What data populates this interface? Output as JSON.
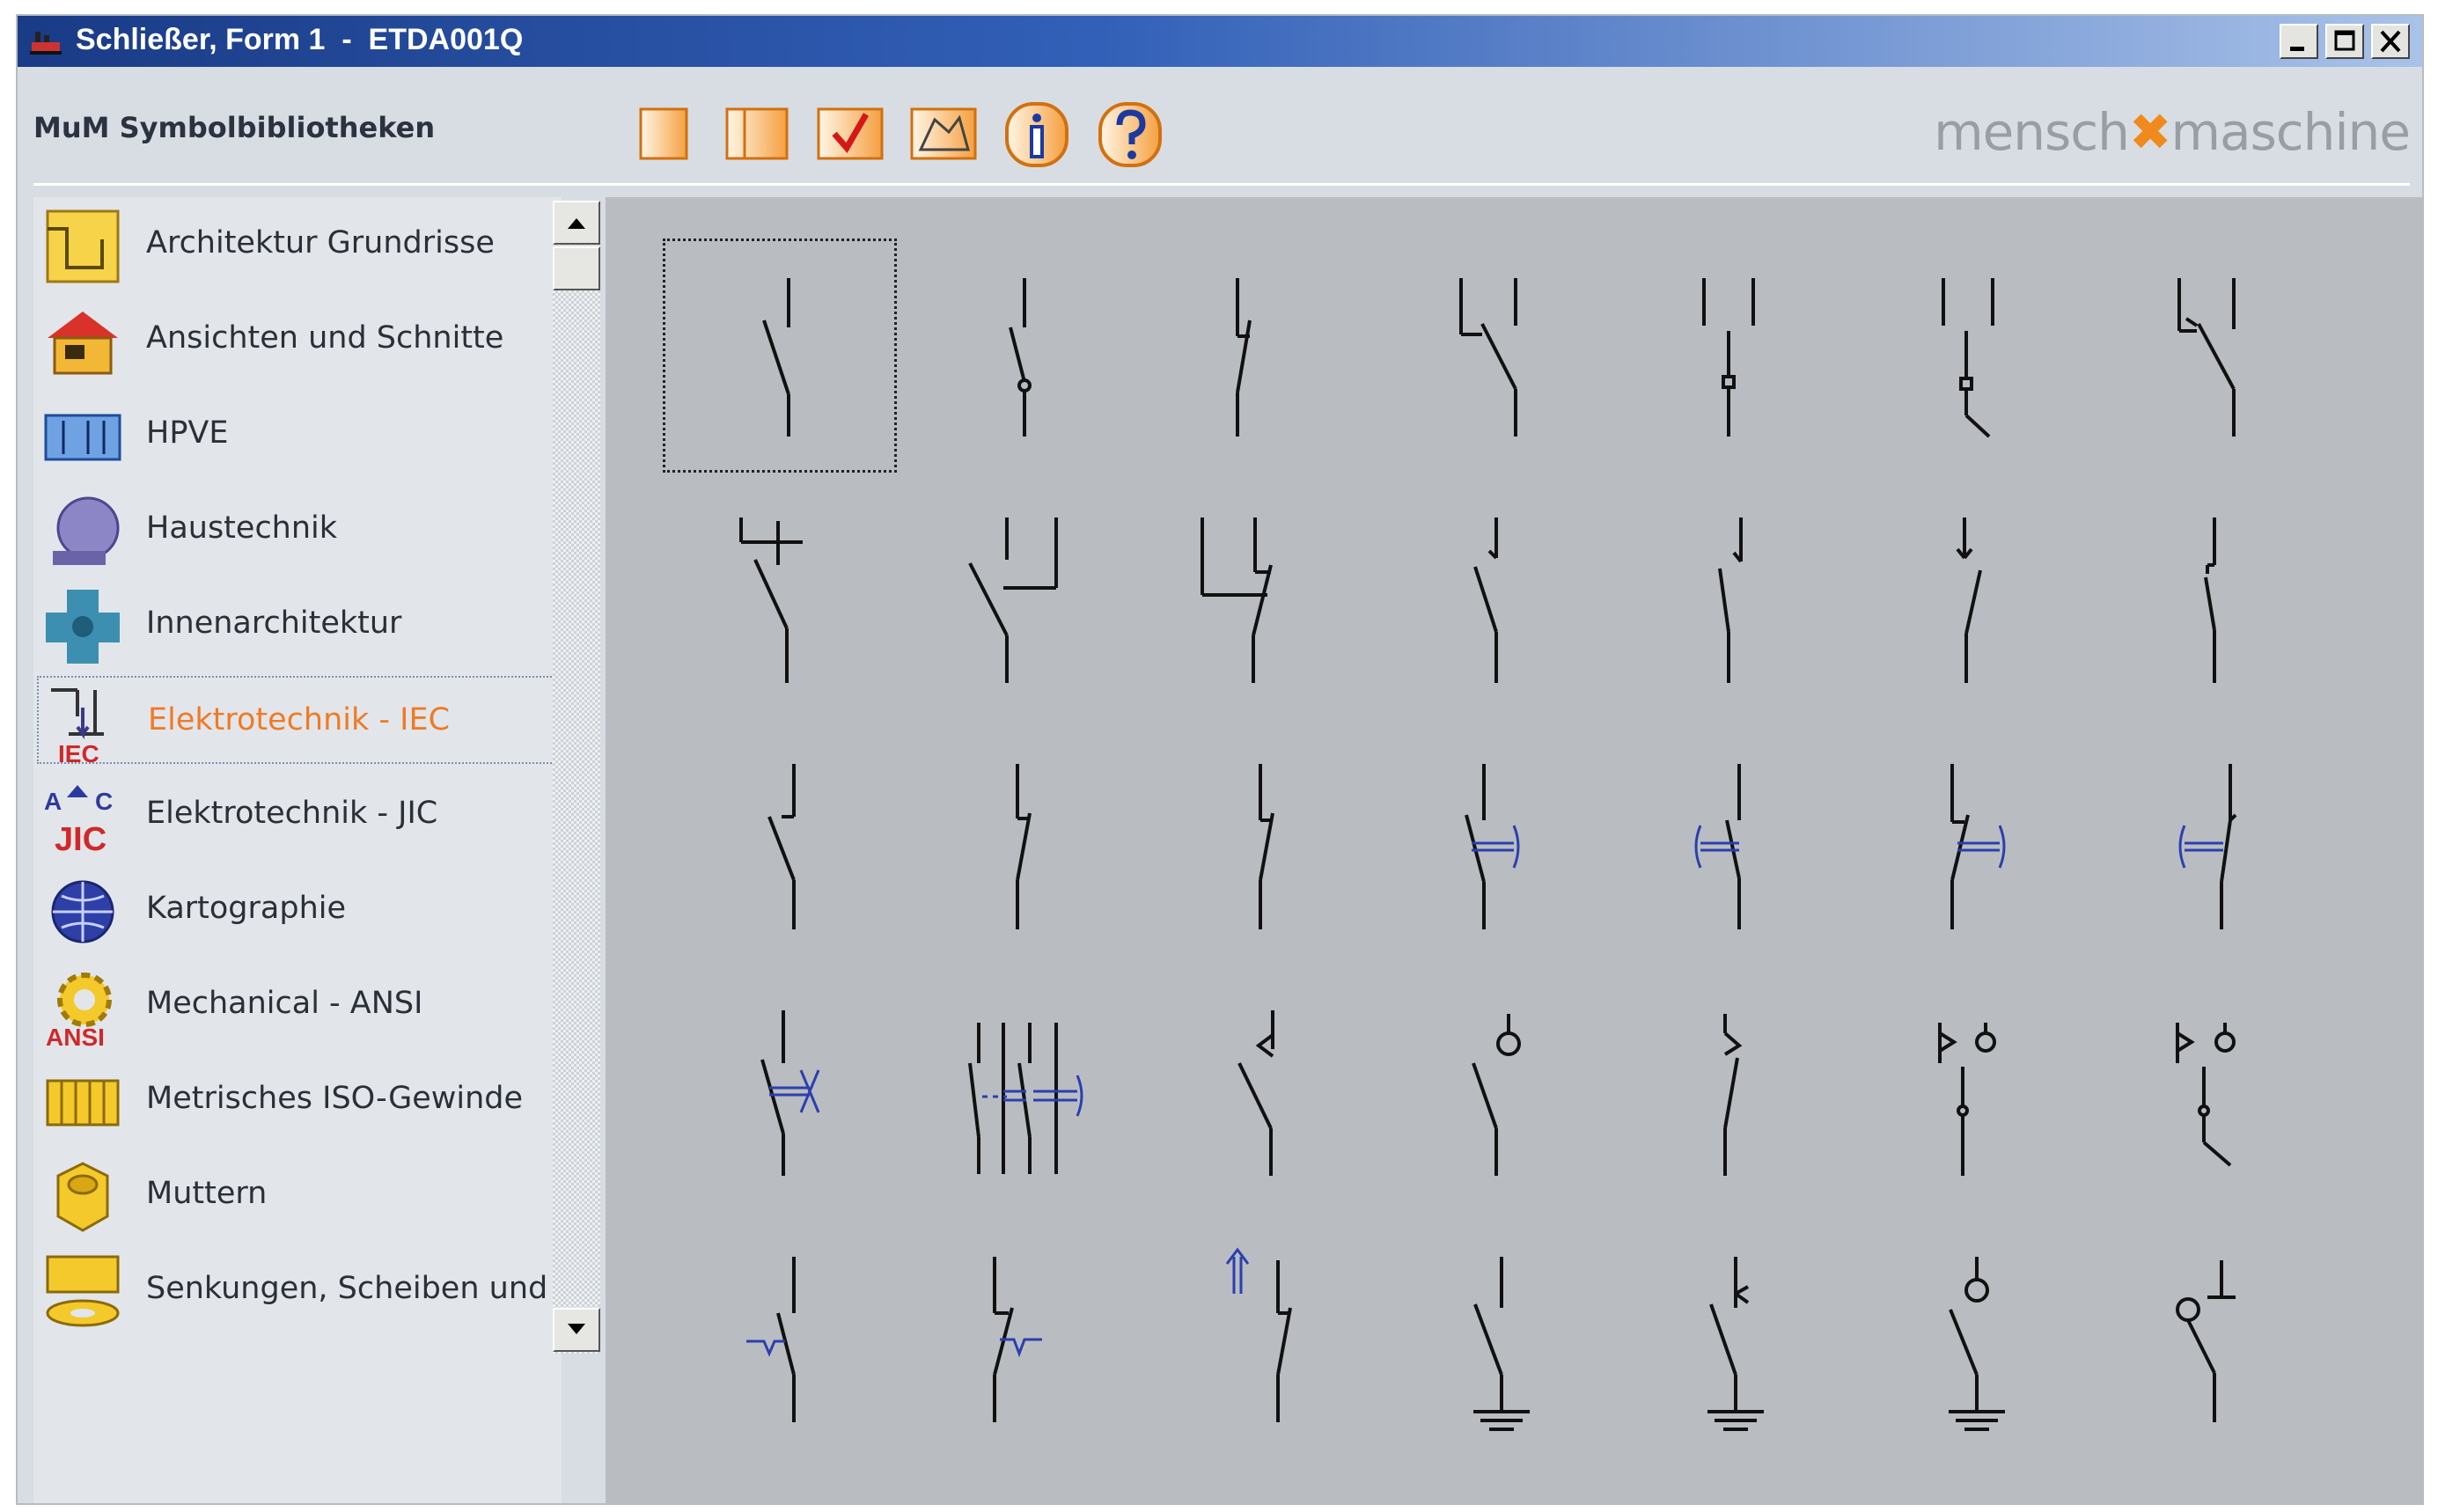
{
  "window": {
    "title": "Schließer, Form 1  -  ETDA001Q"
  },
  "toolbar": {
    "label": "MuM Symbolbibliotheken",
    "buttons": [
      "new-page-icon",
      "open-page-icon",
      "check-icon",
      "edit-polygon-icon",
      "info-icon",
      "help-icon"
    ]
  },
  "logo": {
    "left": "mensch",
    "mid": "✖",
    "right": "maschine"
  },
  "sidebar": {
    "items": [
      {
        "label": "Architektur Grundrisse",
        "icon": "floorplan-icon"
      },
      {
        "label": "Ansichten und Schnitte",
        "icon": "house-icon"
      },
      {
        "label": "HPVE",
        "icon": "hpve-icon"
      },
      {
        "label": "Haustechnik",
        "icon": "hvac-icon"
      },
      {
        "label": "Innenarchitektur",
        "icon": "interior-icon"
      },
      {
        "label": "Elektrotechnik - IEC",
        "icon": "iec-icon",
        "selected": true,
        "badge": "IEC"
      },
      {
        "label": "Elektrotechnik - JIC",
        "icon": "jic-icon",
        "badge": "JIC"
      },
      {
        "label": "Kartographie",
        "icon": "globe-icon"
      },
      {
        "label": "Mechanical - ANSI",
        "icon": "gear-icon",
        "badge": "ANSI"
      },
      {
        "label": "Metrisches ISO-Gewinde",
        "icon": "thread-icon"
      },
      {
        "label": "Muttern",
        "icon": "nut-icon"
      },
      {
        "label": "Senkungen, Scheiben und Du",
        "icon": "washer-icon"
      }
    ]
  },
  "colors": {
    "accent": "#f07a24",
    "symbol_blue": "#2b3fae",
    "titlebar": "#1a3b86"
  }
}
